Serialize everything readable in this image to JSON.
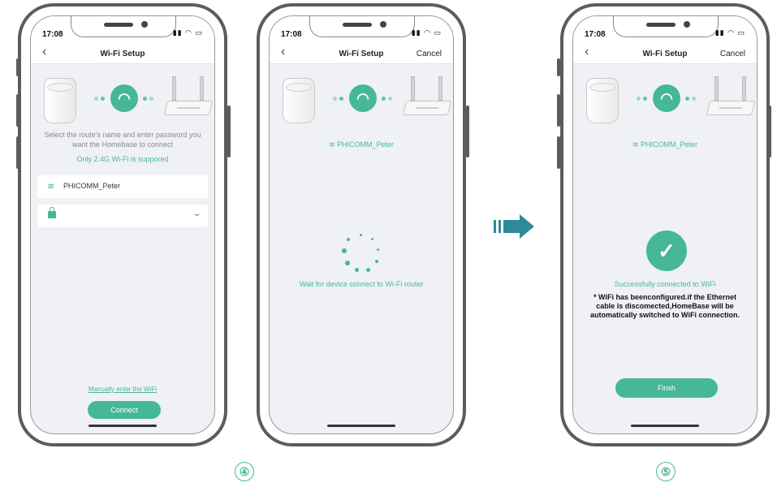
{
  "colors": {
    "accent": "#46b896",
    "frame": "#5c5c5c",
    "arrow": "#2f8a98"
  },
  "status_bar": {
    "time": "17:08",
    "icons": "signal-wifi-battery"
  },
  "phone1": {
    "title": "Wi-Fi Setup",
    "back_icon": "chevron-left-icon",
    "description_line1": "Select the route's name and enter password you",
    "description_line2": "want the Homebase to connect",
    "band_note": "Only 2.4G Wi-Fi is suppored",
    "ssid_field": "PHICOMM_Peter",
    "password_field": "",
    "manual_link": "Manually enter the WiFi",
    "connect_button": "Connect"
  },
  "phone2": {
    "title": "Wi-Fi Setup",
    "cancel": "Cancel",
    "ssid": "PHICOMM_Peter",
    "waiting_text": "Wait for device connect to Wi-Fi router"
  },
  "phone3": {
    "title": "Wi-Fi Setup",
    "cancel": "Cancel",
    "ssid": "PHICOMM_Peter",
    "success_text": "Successfully connected to WiFi",
    "note_line1": "* WiFi has beenconfigured.if the Ethernet",
    "note_line2": "cable is discomected,HomeBase will be",
    "note_line3": "automatically switched to WiFi connection.",
    "finish_button": "Finsh"
  },
  "steps": {
    "step4": "④",
    "step5": "⑤"
  }
}
